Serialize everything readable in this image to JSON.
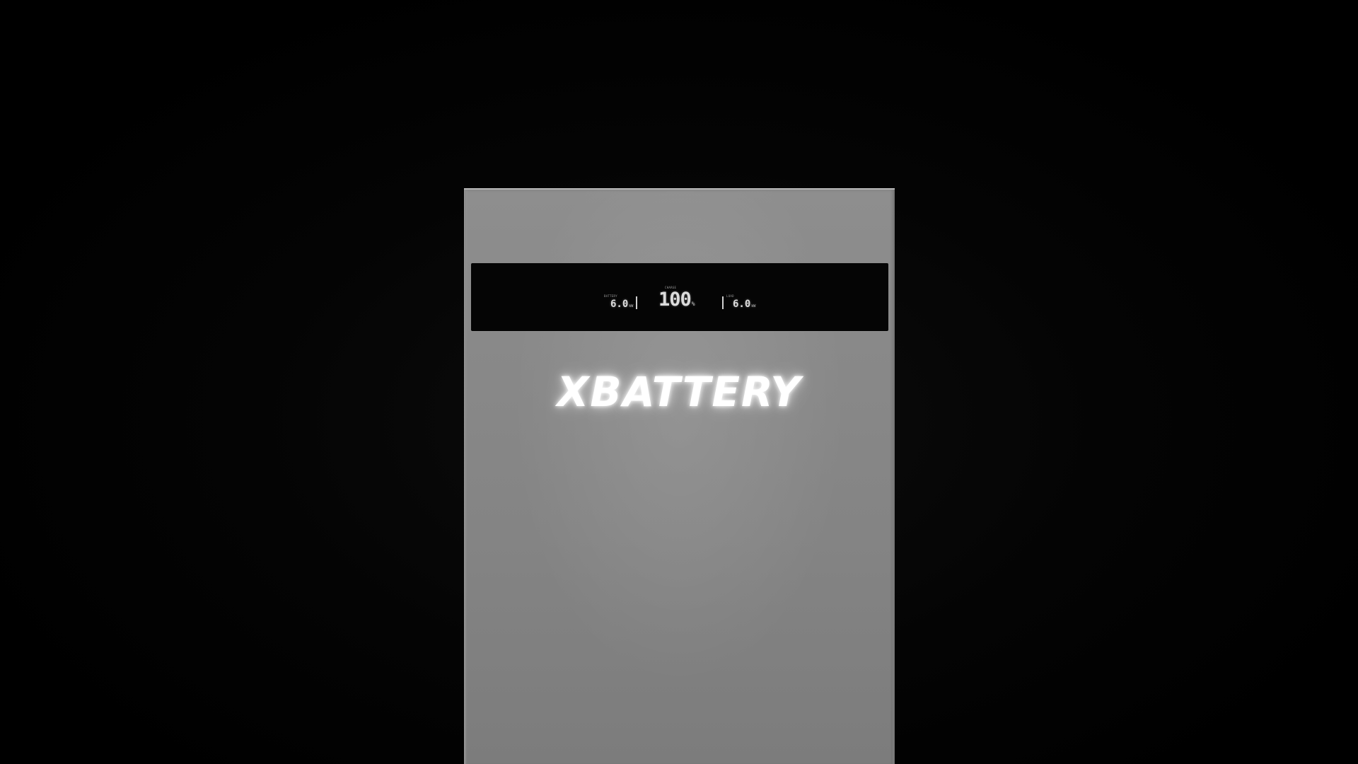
{
  "device": {
    "brand": "XBATTERY",
    "display": {
      "left": {
        "caption": "BATTERY",
        "value": "6.0",
        "unit": "kW"
      },
      "center": {
        "caption": "CHARGE",
        "value": "100",
        "unit": "%"
      },
      "right": {
        "caption": "LOAD",
        "value": "6.0",
        "unit": "kW"
      }
    }
  },
  "colors": {
    "background": "#000000",
    "cabinet": "#888888",
    "display_panel": "#050505",
    "glow_text": "#ffffff"
  }
}
